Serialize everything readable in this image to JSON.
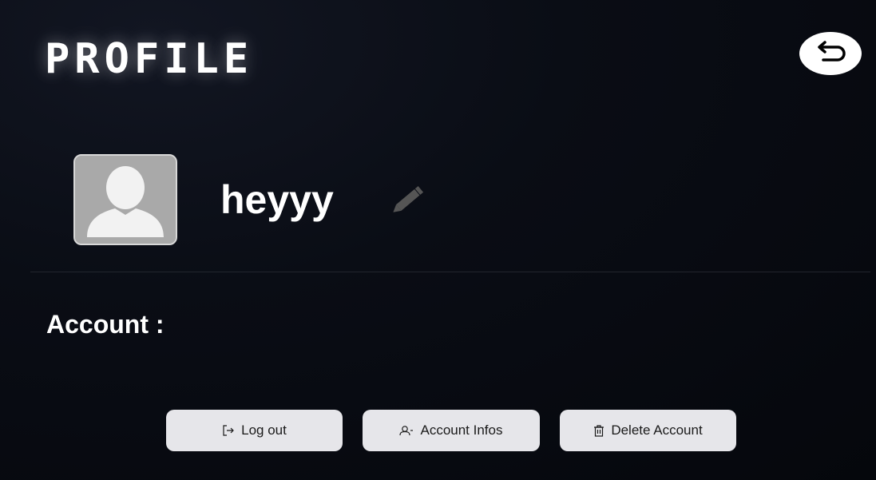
{
  "page": {
    "title": "PROFILE"
  },
  "profile": {
    "username": "heyyy"
  },
  "account": {
    "section_label": "Account :",
    "buttons": {
      "logout_label": "Log out",
      "infos_label": "Account Infos",
      "delete_label": "Delete Account"
    }
  },
  "icons": {
    "back": "back-arrow-icon",
    "avatar": "user-silhouette-icon",
    "edit": "pencil-icon",
    "logout": "logout-icon",
    "infos": "user-icon",
    "delete": "trash-icon"
  },
  "colors": {
    "background": "#080a10",
    "button_bg": "#e6e6ea",
    "avatar_bg": "#a9a9a9"
  }
}
